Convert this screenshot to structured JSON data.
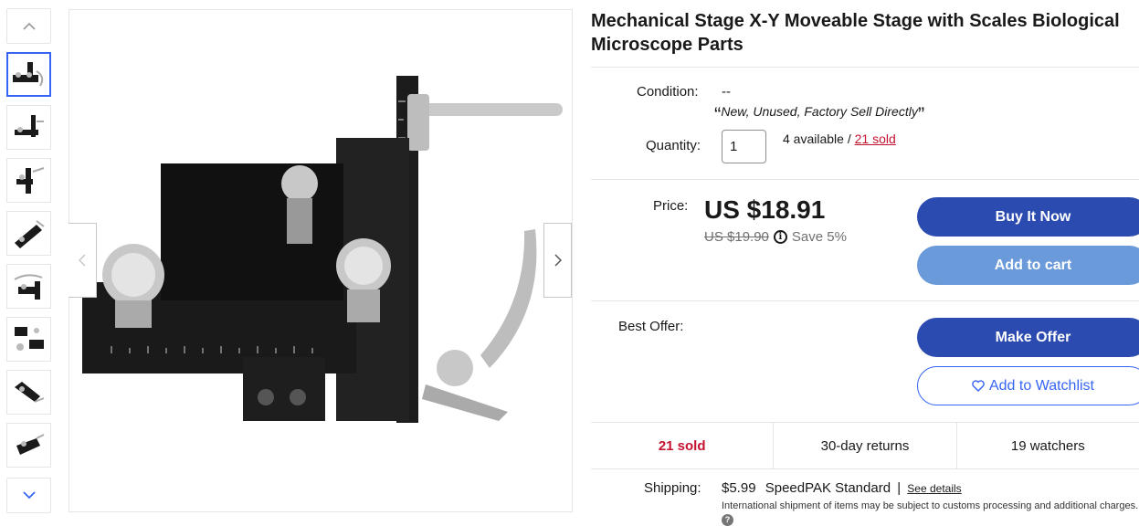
{
  "product": {
    "title": "Mechanical Stage X-Y Moveable Stage with Scales Biological Microscope Parts"
  },
  "gallery": {
    "thumbnail_count": 8,
    "active_index": 0,
    "up_icon": "chevron-up-icon",
    "down_icon": "chevron-down-icon",
    "prev_icon": "chevron-left-icon",
    "next_icon": "chevron-right-icon"
  },
  "condition": {
    "label": "Condition:",
    "value": "--",
    "description": "New, Unused, Factory Sell Directly",
    "open_quote": "“",
    "close_quote": "”"
  },
  "quantity": {
    "label": "Quantity:",
    "value": "1",
    "available": "4 available /",
    "sold_link": "21 sold"
  },
  "price": {
    "label": "Price:",
    "current": "US $18.91",
    "was": "US $19.90",
    "info_icon": "info-icon",
    "info_glyph": "i",
    "save": "Save 5%"
  },
  "buttons": {
    "buy_now": "Buy It Now",
    "add_to_cart": "Add to cart",
    "make_offer": "Make Offer",
    "watchlist": "Add to Watchlist",
    "watchlist_icon": "heart-icon"
  },
  "best_offer": {
    "label": "Best Offer:"
  },
  "stats": {
    "sold": "21 sold",
    "returns": "30-day returns",
    "watchers": "19 watchers"
  },
  "shipping": {
    "label": "Shipping:",
    "price": "$5.99",
    "method": "SpeedPAK Standard",
    "separator": "|",
    "details_link": "See details",
    "note": "International shipment of items may be subject to customs processing and additional charges.",
    "help_icon": "question-icon",
    "help_glyph": "?"
  },
  "colors": {
    "primary_button": "#2c4bb0",
    "secondary_button": "#6a9ad9",
    "sold_red": "#c41230",
    "link_blue": "#3665f3"
  }
}
